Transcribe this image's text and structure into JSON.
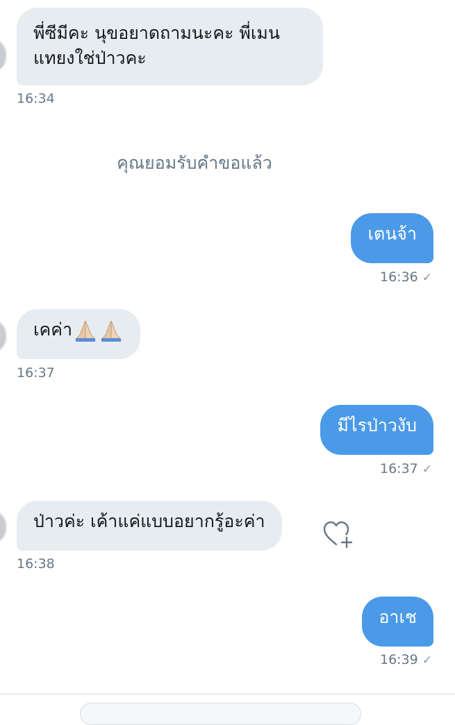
{
  "messages": [
    {
      "from": "them",
      "lines": [
        "พี่ซีมีคะ นุขอยาดถามนะคะ พี่เมน",
        "แทยงใช่ป่าวคะ"
      ],
      "time": "16:34"
    },
    {
      "from": "me",
      "text": "เตนจ้า",
      "time": "16:36"
    },
    {
      "from": "them",
      "text": "เคค่า",
      "emoji": "folded-hands-icon",
      "time": "16:37"
    },
    {
      "from": "me",
      "text": "มีไรป่าวงับ",
      "time": "16:37"
    },
    {
      "from": "them",
      "text": "ป่าวค่ะ เค้าแค่แบบอยากรู้อะค่า",
      "time": "16:38"
    },
    {
      "from": "me",
      "text": "อาเช",
      "time": "16:39"
    }
  ],
  "system_notice": "คุณยอมรับคำขอแล้ว",
  "read_mark": "✓",
  "icons": {
    "react": "heart-plus-icon",
    "emoji": "folded-hands-icon"
  },
  "colors": {
    "sent_bubble": "#4b9ae8",
    "received_bubble": "#e6ecf0",
    "muted_text": "#657786"
  }
}
